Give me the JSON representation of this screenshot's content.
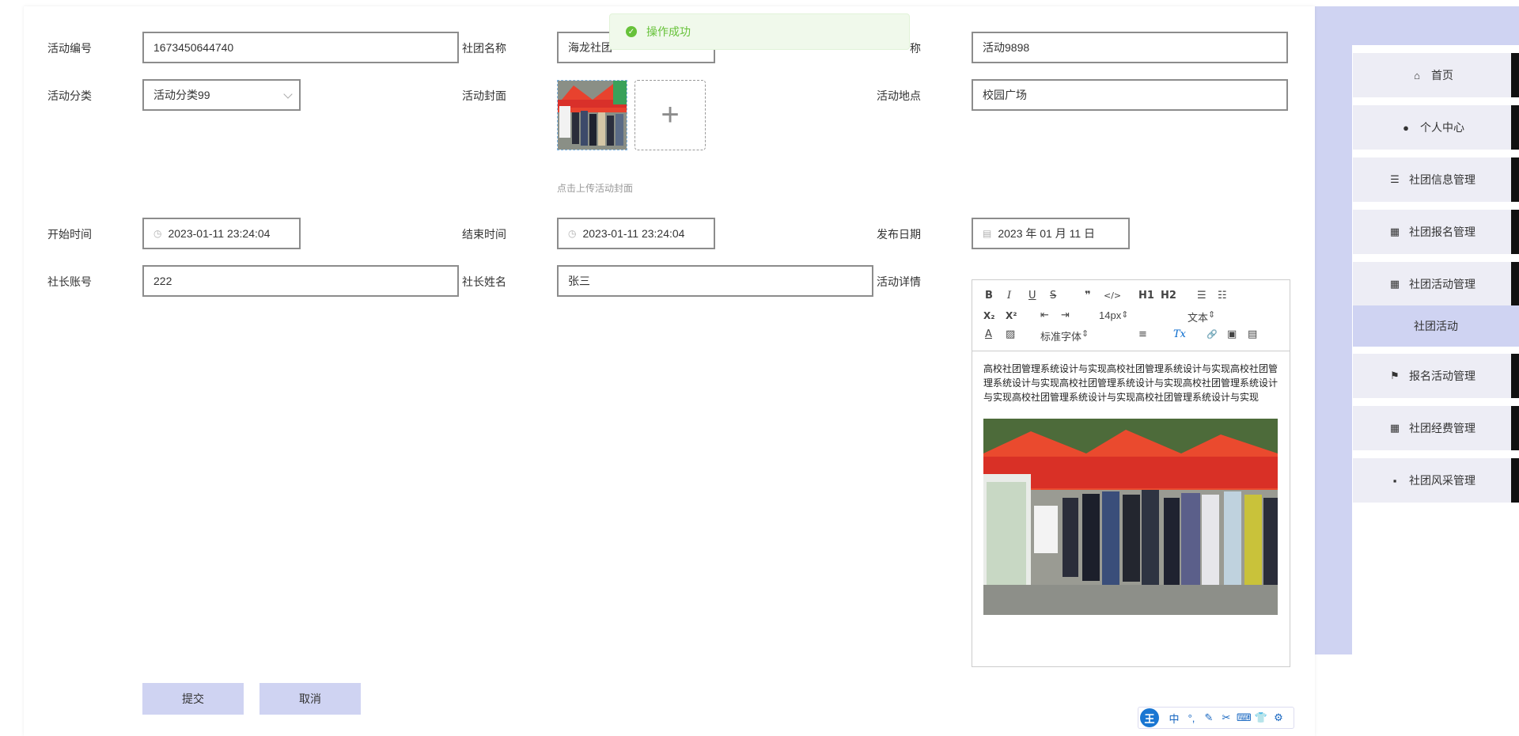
{
  "form": {
    "labels": {
      "activity_no": "活动编号",
      "club_name": "社团名称",
      "activity_name_partial": "称",
      "category": "活动分类",
      "cover": "活动封面",
      "location": "活动地点",
      "start_time": "开始时间",
      "end_time": "结束时间",
      "publish_date": "发布日期",
      "leader_account": "社长账号",
      "leader_name": "社长姓名",
      "details": "活动详情"
    },
    "values": {
      "activity_no": "1673450644740",
      "club_name": "海龙社团",
      "activity_name": "活动9898",
      "category": "活动分类99",
      "location": "校园广场",
      "start_time": "2023-01-11 23:24:04",
      "end_time": "2023-01-11 23:24:04",
      "publish_date": "2023 年 01 月 11 日",
      "leader_account": "222",
      "leader_name": "张三"
    },
    "upload_tip": "点击上传活动封面",
    "upload_plus": "+"
  },
  "toast": {
    "message": "操作成功"
  },
  "editor": {
    "toolbar": {
      "bold": "B",
      "italic": "I",
      "underline": "U",
      "strike": "S",
      "quote": "❞",
      "code": "</>",
      "h1": "H1",
      "h2": "H2",
      "ordered_list": "☰",
      "bullet_list": "☷",
      "sub": "X₂",
      "sup": "X²",
      "outdent": "⇤",
      "indent": "⇥",
      "size": "14px",
      "header": "文本",
      "color": "A",
      "background": "▨",
      "font": "标准字体",
      "align": "≡",
      "clean": "Tx",
      "link": "🔗",
      "image": "▣",
      "video": "▤"
    },
    "content": "高校社团管理系统设计与实现高校社团管理系统设计与实现高校社团管理系统设计与实现高校社团管理系统设计与实现高校社团管理系统设计与实现高校社团管理系统设计与实现高校社团管理系统设计与实现"
  },
  "buttons": {
    "submit": "提交",
    "cancel": "取消"
  },
  "sidebar": {
    "items": [
      {
        "label": "首页",
        "icon": "home-icon"
      },
      {
        "label": "个人中心",
        "icon": "user-icon"
      },
      {
        "label": "社团信息管理",
        "icon": "sliders-icon"
      },
      {
        "label": "社团报名管理",
        "icon": "grid-icon"
      },
      {
        "label": "社团活动管理",
        "icon": "grid-icon"
      },
      {
        "label": "报名活动管理",
        "icon": "flag-icon"
      },
      {
        "label": "社团经费管理",
        "icon": "grid-icon"
      },
      {
        "label": "社团风采管理",
        "icon": "chat-icon"
      }
    ],
    "submenu_active": "社团活动"
  },
  "ime": {
    "logo": "王",
    "mode": "中",
    "punct": "°,",
    "tools": [
      "✎",
      "✂",
      "⌨",
      "👕",
      "⚙"
    ]
  },
  "colors": {
    "accent": "#cfd3f2",
    "success": "#67c23a",
    "border": "#8c8c8c"
  }
}
